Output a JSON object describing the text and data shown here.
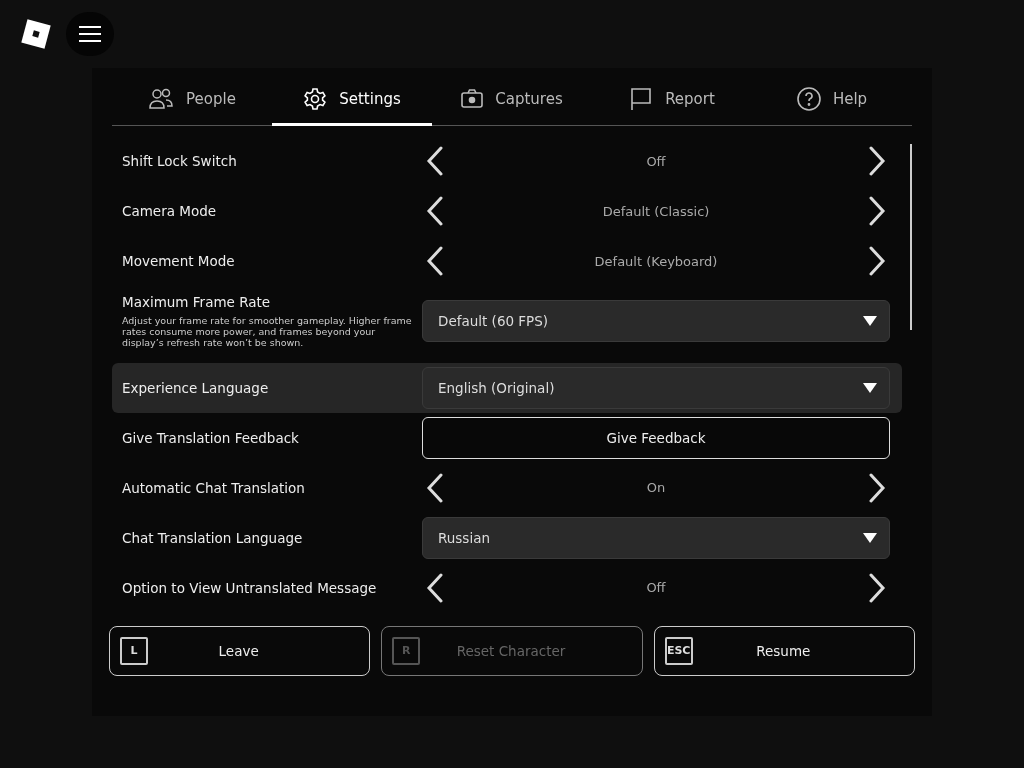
{
  "tabs": [
    {
      "label": "People",
      "kind": "people",
      "selected": false
    },
    {
      "label": "Settings",
      "kind": "settings",
      "selected": true
    },
    {
      "label": "Captures",
      "kind": "captures",
      "selected": false
    },
    {
      "label": "Report",
      "kind": "report",
      "selected": false
    },
    {
      "label": "Help",
      "kind": "help",
      "selected": false
    }
  ],
  "settings": [
    {
      "kind": "toggle",
      "label": "Shift Lock Switch",
      "value": "Off",
      "selected": false
    },
    {
      "kind": "toggle",
      "label": "Camera Mode",
      "value": "Default (Classic)",
      "selected": false
    },
    {
      "kind": "toggle",
      "label": "Movement Mode",
      "value": "Default (Keyboard)",
      "selected": false
    },
    {
      "kind": "dropdown",
      "label": "Maximum Frame Rate",
      "description": "Adjust your frame rate for smoother gameplay. Higher frame rates consume more power, and frames beyond your display’s refresh rate won’t be shown.",
      "value": "Default (60 FPS)",
      "selected": false
    },
    {
      "kind": "dropdown",
      "label": "Experience Language",
      "value": "English (Original)",
      "selected": true
    },
    {
      "kind": "button",
      "label": "Give Translation Feedback",
      "value": "Give Feedback",
      "selected": false
    },
    {
      "kind": "toggle",
      "label": "Automatic Chat Translation",
      "value": "On",
      "selected": false
    },
    {
      "kind": "dropdown",
      "label": "Chat Translation Language",
      "value": "Russian",
      "selected": false
    },
    {
      "kind": "toggle",
      "label": "Option to View Untranslated Message",
      "value": "Off",
      "selected": false
    }
  ],
  "actions": [
    {
      "key": "L",
      "label": "Leave",
      "disabled": false
    },
    {
      "key": "R",
      "label": "Reset Character",
      "disabled": true
    },
    {
      "key": "ESC",
      "label": "Resume",
      "disabled": false
    }
  ]
}
